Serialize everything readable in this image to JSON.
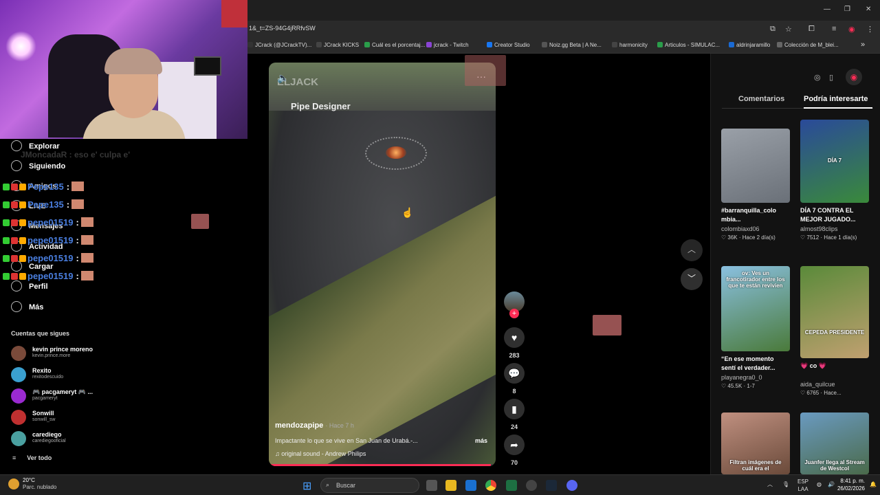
{
  "browser": {
    "url": "1&_t=ZS-94G4jRRfvSW",
    "bookmarks": [
      "JCrack (@JCrackTV)...",
      "JCrack KICKS",
      "Cuál es el porcentaj...",
      "jcrack - Twitch",
      "Creator Studio",
      "Noiz.gg Beta | A Ne...",
      "harmonicity",
      "Articulos - SIMULAC...",
      "aldrinjaramillo",
      "Colección de M_blei..."
    ],
    "bookmark_colors": [
      "#333",
      "#444",
      "#2a9d4a",
      "#8a44d4",
      "#1877f2",
      "#555",
      "#444",
      "#2a9d4a",
      "#1a6ad4",
      "#666"
    ],
    "more": "»"
  },
  "nav": {
    "items": [
      {
        "label": "Explorar",
        "icon": "compass-icon"
      },
      {
        "label": "Siguiendo",
        "icon": "following-icon"
      },
      {
        "label": "Amigos",
        "icon": "friends-icon"
      },
      {
        "label": "LIVE",
        "icon": "live-icon"
      },
      {
        "label": "Mensajes",
        "icon": "messages-icon"
      },
      {
        "label": "Actividad",
        "icon": "activity-icon"
      },
      {
        "label": "Cargar",
        "icon": "upload-icon"
      },
      {
        "label": "Perfil",
        "icon": "profile-icon"
      },
      {
        "label": "Más",
        "icon": "more-icon"
      }
    ],
    "following_title": "Cuentas que sigues",
    "following": [
      {
        "name": "kevin prince moreno",
        "handle": "kevin.prince.more",
        "color": "#7a4a3a"
      },
      {
        "name": "Rexito",
        "handle": "rexitodescuido",
        "color": "#3aa0d0"
      },
      {
        "name": "🎮 pacgameryt 🎮 ...",
        "handle": "pacgameryt",
        "color": "#9a2ad0"
      },
      {
        "name": "Sonwill",
        "handle": "sonwill_sw",
        "color": "#c03030"
      },
      {
        "name": "carediego",
        "handle": "carediegooficial",
        "color": "#4aa0a0"
      }
    ],
    "see_all": "Ver todo"
  },
  "chat": {
    "faded": "JMoncadaR : eso e' culpa e'",
    "lines": [
      {
        "user": "Pepe135",
        "sep": ":"
      },
      {
        "user": "Pepe135",
        "sep": ":"
      },
      {
        "user": "pepe01519",
        "sep": ":"
      },
      {
        "user": "pepe01519",
        "sep": ":"
      },
      {
        "user": "pepe01519",
        "sep": ":"
      },
      {
        "user": "pepe01519",
        "sep": ":"
      }
    ]
  },
  "video": {
    "brand": "ELJACK",
    "designer": "Pipe Designer",
    "author": "mendozapipe",
    "time": "· Hace 7 h",
    "description": "Impactante lo que se vive en San Juan de Urabá.-...",
    "more": "más",
    "sound": "♫  original sound - Andrew Philips",
    "progress": 0.98
  },
  "actions": {
    "likes": "283",
    "comments": "8",
    "saves": "24",
    "shares": "70"
  },
  "side": {
    "tabs": [
      "Comentarios",
      "Podría interesarte"
    ],
    "cards": [
      {
        "title": "#barranquilla_colo mbia...",
        "user": "colombiaxd06",
        "stats": "♡ 36K  · Hace 2 día(s)",
        "thumb_text": "",
        "colors": [
          "#9aa0a8",
          "#6a7078"
        ]
      },
      {
        "title": "DÍA 7 CONTRA EL MEJOR JUGADO...",
        "user": "almost98clips",
        "stats": "♡ 7512  · Hace 1 día(s)",
        "thumb_text": "DÍA 7",
        "colors": [
          "#2a4a9a",
          "#3a8a3a"
        ]
      },
      {
        "title": "“En ese momento sentí el verdader...",
        "user": "playanegra0_0",
        "stats": "♡ 45.5K  · 1-7",
        "thumb_text": "ov: Ves un francotirador entre los que te están revivien",
        "colors": [
          "#8ac0e0",
          "#4a7a3a"
        ]
      },
      {
        "title": "💗 co 💗",
        "user": "aida_quilcue",
        "stats": "♡ 6765  · Hace...",
        "thumb_text": "CEPEDA PRESIDENTE",
        "colors": [
          "#5a8a3a",
          "#c0a070"
        ]
      },
      {
        "title": "",
        "user": "",
        "stats": "",
        "thumb_text": "Filtran imágenes de cuál era el",
        "colors": [
          "#c09080",
          "#6a4a3a"
        ]
      },
      {
        "title": "",
        "user": "",
        "stats": "",
        "thumb_text": "Juanfer llega al Stream de Westcol",
        "colors": [
          "#6a9ac0",
          "#4a6a4a"
        ]
      }
    ]
  },
  "taskbar": {
    "temp": "20°C",
    "weather": "Parc. nublado",
    "search": "Buscar",
    "lang": "ESP",
    "lang2": "LAA",
    "time": "8:41 p. m.",
    "date": "26/02/2026"
  }
}
